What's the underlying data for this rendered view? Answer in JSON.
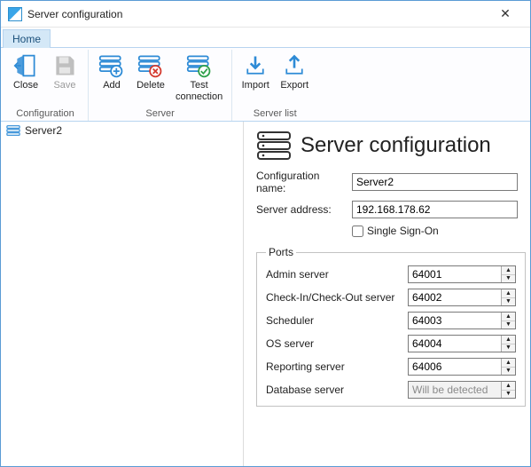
{
  "window": {
    "title": "Server configuration",
    "close_glyph": "✕"
  },
  "tabs": {
    "home": "Home"
  },
  "ribbon": {
    "configuration": {
      "label": "Configuration",
      "close": "Close",
      "save": "Save"
    },
    "server": {
      "label": "Server",
      "add": "Add",
      "delete": "Delete",
      "test": "Test\nconnection"
    },
    "serverlist": {
      "label": "Server list",
      "import": "Import",
      "export": "Export"
    }
  },
  "tree": {
    "items": [
      {
        "label": "Server2"
      }
    ]
  },
  "detail": {
    "title": "Server configuration",
    "config_name_label": "Configuration name:",
    "config_name_value": "Server2",
    "server_address_label": "Server address:",
    "server_address_value": "192.168.178.62",
    "sso_label": "Single Sign-On",
    "sso_checked": false,
    "ports": {
      "legend": "Ports",
      "admin_label": "Admin server",
      "admin_value": "64001",
      "cico_label": "Check-In/Check-Out server",
      "cico_value": "64002",
      "scheduler_label": "Scheduler",
      "scheduler_value": "64003",
      "os_label": "OS server",
      "os_value": "64004",
      "reporting_label": "Reporting server",
      "reporting_value": "64006",
      "database_label": "Database server",
      "database_placeholder": "Will be detected"
    }
  }
}
